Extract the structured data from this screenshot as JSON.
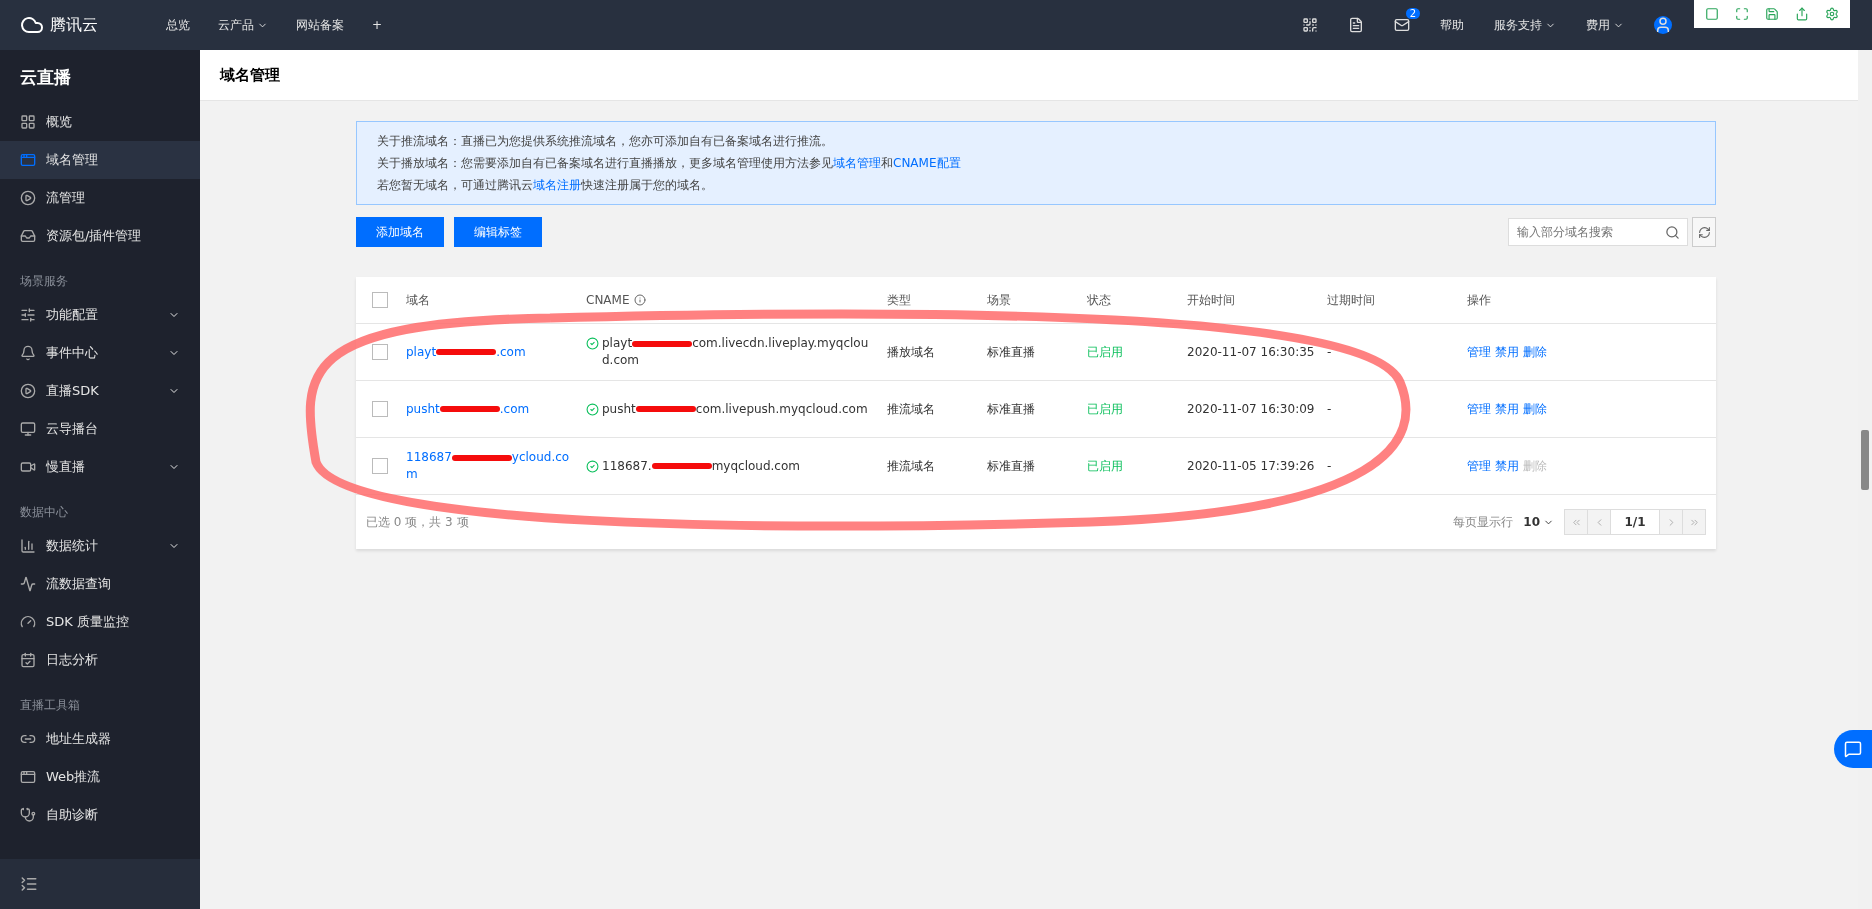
{
  "topbar": {
    "brand": "腾讯云",
    "nav": [
      {
        "label": "总览",
        "dropdown": false
      },
      {
        "label": "云产品",
        "dropdown": true
      },
      {
        "label": "网站备案",
        "dropdown": false
      },
      {
        "label": "+",
        "dropdown": false
      }
    ],
    "right": [
      {
        "kind": "icon"
      },
      {
        "kind": "icon"
      },
      {
        "kind": "mail",
        "badge": "2"
      },
      {
        "kind": "text",
        "label": "帮助",
        "dropdown": false
      },
      {
        "kind": "text",
        "label": "服务支持",
        "dropdown": true
      },
      {
        "kind": "text",
        "label": "费用",
        "dropdown": true
      },
      {
        "kind": "avatar"
      }
    ]
  },
  "sidebar": {
    "title": "云直播",
    "items": [
      {
        "kind": "item",
        "label": "概览",
        "selected": false,
        "dropdown": false
      },
      {
        "kind": "item",
        "label": "域名管理",
        "selected": true,
        "dropdown": false
      },
      {
        "kind": "item",
        "label": "流管理",
        "selected": false,
        "dropdown": false
      },
      {
        "kind": "item",
        "label": "资源包/插件管理",
        "selected": false,
        "dropdown": false
      },
      {
        "kind": "group",
        "label": "场景服务"
      },
      {
        "kind": "item",
        "label": "功能配置",
        "selected": false,
        "dropdown": true
      },
      {
        "kind": "item",
        "label": "事件中心",
        "selected": false,
        "dropdown": true
      },
      {
        "kind": "item",
        "label": "直播SDK",
        "selected": false,
        "dropdown": true
      },
      {
        "kind": "item",
        "label": "云导播台",
        "selected": false,
        "dropdown": false
      },
      {
        "kind": "item",
        "label": "慢直播",
        "selected": false,
        "dropdown": true
      },
      {
        "kind": "group",
        "label": "数据中心"
      },
      {
        "kind": "item",
        "label": "数据统计",
        "selected": false,
        "dropdown": true
      },
      {
        "kind": "item",
        "label": "流数据查询",
        "selected": false,
        "dropdown": false
      },
      {
        "kind": "item",
        "label": "SDK 质量监控",
        "selected": false,
        "dropdown": false
      },
      {
        "kind": "item",
        "label": "日志分析",
        "selected": false,
        "dropdown": false
      },
      {
        "kind": "group",
        "label": "直播工具箱"
      },
      {
        "kind": "item",
        "label": "地址生成器",
        "selected": false,
        "dropdown": false
      },
      {
        "kind": "item",
        "label": "Web推流",
        "selected": false,
        "dropdown": false
      },
      {
        "kind": "item",
        "label": "自助诊断",
        "selected": false,
        "dropdown": false
      }
    ]
  },
  "page": {
    "title": "域名管理"
  },
  "notice": [
    [
      {
        "kind": "text",
        "text": "关于推流域名：直播已为您提供系统推流域名，您亦可添加自有已备案域名进行推流。"
      }
    ],
    [
      {
        "kind": "text",
        "text": "关于播放域名：您需要添加自有已备案域名进行直播播放，更多域名管理使用方法参见"
      },
      {
        "kind": "link",
        "text": "域名管理"
      },
      {
        "kind": "text",
        "text": "和"
      },
      {
        "kind": "link",
        "text": "CNAME配置"
      }
    ],
    [
      {
        "kind": "text",
        "text": "若您暂无域名，可通过腾讯云"
      },
      {
        "kind": "link",
        "text": "域名注册"
      },
      {
        "kind": "text",
        "text": "快速注册属于您的域名。"
      }
    ]
  ],
  "actions": [
    "添加域名",
    "编辑标签"
  ],
  "search": {
    "placeholder": "输入部分域名搜索"
  },
  "table": {
    "all_checked": false,
    "columns": [
      "域名",
      "CNAME",
      "类型",
      "场景",
      "状态",
      "开始时间",
      "过期时间",
      "操作"
    ],
    "rows": [
      {
        "checked": false,
        "domain": [
          "playt",
          ".com"
        ],
        "cname": [
          "playt",
          "com.livecdn.liveplay.myqcloud.com"
        ],
        "type": "播放域名",
        "scene": "标准直播",
        "status": "已启用",
        "start": "2020-11-07 16:30:35",
        "expire": "-",
        "ops": [
          {
            "label": "管理",
            "disabled": false
          },
          {
            "label": "禁用",
            "disabled": false
          },
          {
            "label": "删除",
            "disabled": false
          }
        ]
      },
      {
        "checked": false,
        "domain": [
          "pusht",
          ".com"
        ],
        "cname": [
          "pusht",
          "com.livepush.myqcloud.com"
        ],
        "type": "推流域名",
        "scene": "标准直播",
        "status": "已启用",
        "start": "2020-11-07 16:30:09",
        "expire": "-",
        "ops": [
          {
            "label": "管理",
            "disabled": false
          },
          {
            "label": "禁用",
            "disabled": false
          },
          {
            "label": "删除",
            "disabled": false
          }
        ]
      },
      {
        "checked": false,
        "domain": [
          "118687",
          "ycloud.com"
        ],
        "cname": [
          "118687.",
          "myqcloud.com"
        ],
        "type": "推流域名",
        "scene": "标准直播",
        "status": "已启用",
        "start": "2020-11-05 17:39:26",
        "expire": "-",
        "ops": [
          {
            "label": "管理",
            "disabled": false
          },
          {
            "label": "禁用",
            "disabled": false
          },
          {
            "label": "删除",
            "disabled": true
          }
        ]
      }
    ]
  },
  "footer": {
    "summary": "已选 0 项，共 3 项",
    "page_size_label": "每页显示行",
    "page_size": "10",
    "page": "1/1"
  }
}
